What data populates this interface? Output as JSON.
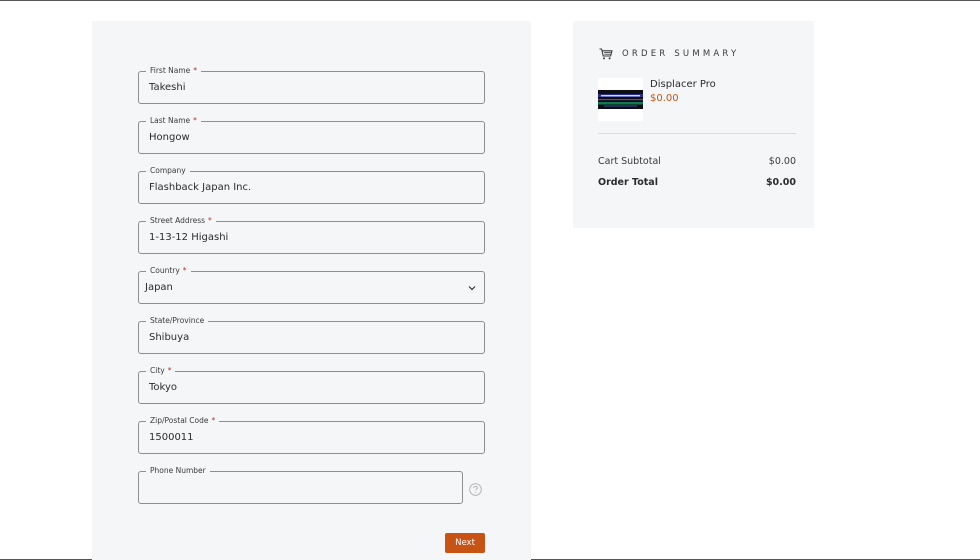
{
  "form": {
    "fields": [
      {
        "label": "First Name",
        "required": "*",
        "value": "Takeshi"
      },
      {
        "label": "Last Name",
        "required": "*",
        "value": "Hongow"
      },
      {
        "label": "Company",
        "required": "",
        "value": "Flashback Japan Inc."
      },
      {
        "label": "Street Address",
        "required": "*",
        "value": "1-13-12 Higashi"
      },
      {
        "label": "Country",
        "required": "*",
        "value": "Japan"
      },
      {
        "label": "State/Province",
        "required": "",
        "value": "Shibuya"
      },
      {
        "label": "City",
        "required": "*",
        "value": "Tokyo"
      },
      {
        "label": "Zip/Postal Code",
        "required": "*",
        "value": "1500011"
      },
      {
        "label": "Phone Number",
        "required": "",
        "value": ""
      }
    ],
    "next_label": "Next"
  },
  "summary": {
    "title": "ORDER SUMMARY",
    "product": {
      "name": "Displacer Pro",
      "price": "$0.00"
    },
    "cart_subtotal_label": "Cart Subtotal",
    "cart_subtotal_value": "$0.00",
    "order_total_label": "Order Total",
    "order_total_value": "$0.00"
  },
  "colors": {
    "accent": "#c75414",
    "required": "#c62828",
    "panel_bg": "#f5f6f8"
  },
  "icons": {
    "cart": "shopping-cart-icon",
    "country_select": "chevron-down-icon",
    "phone_help": "question-circle-icon"
  }
}
